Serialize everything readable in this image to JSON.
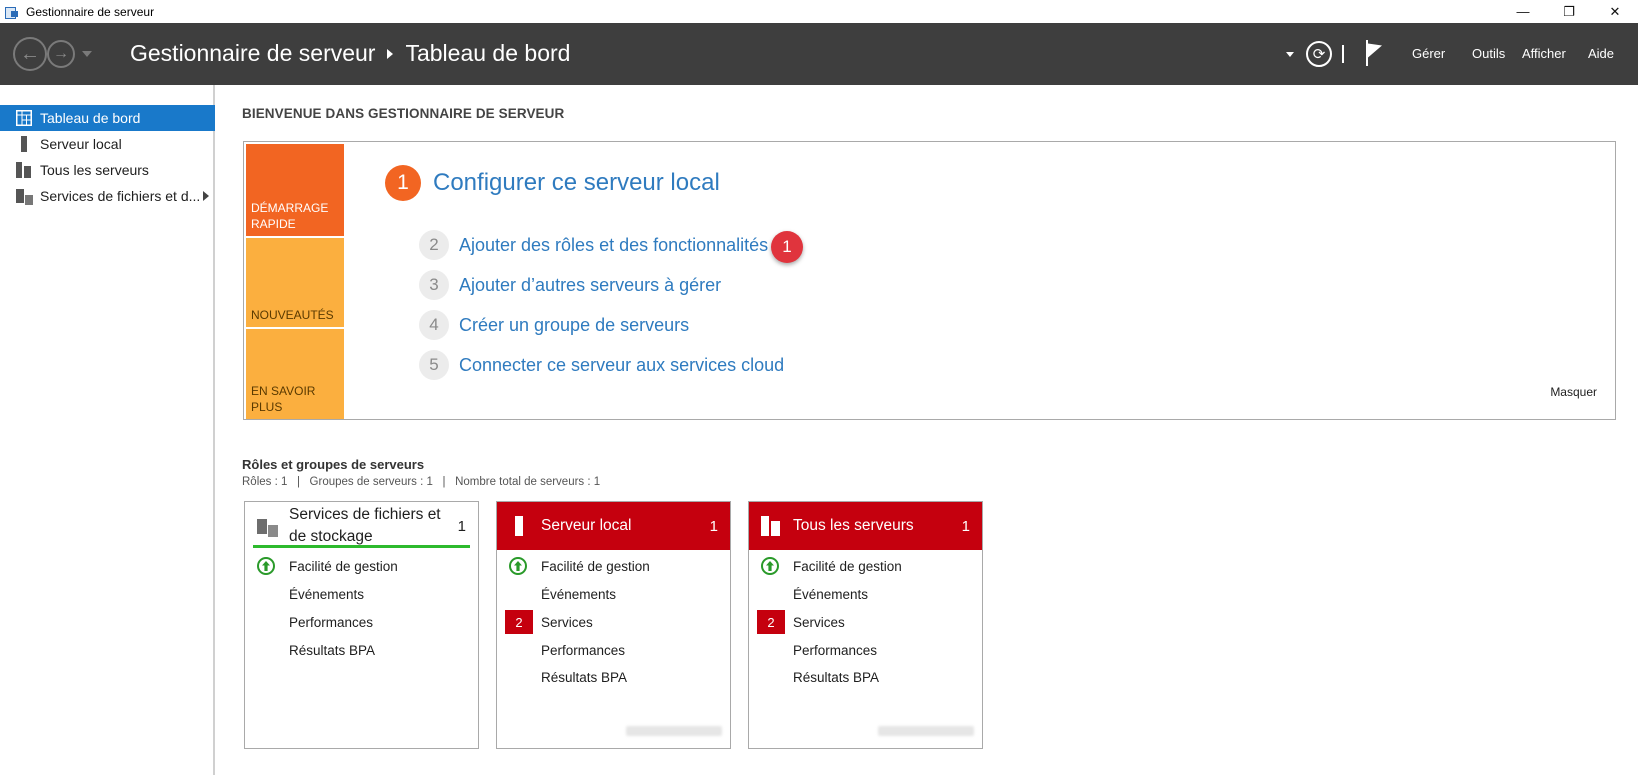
{
  "window": {
    "title": "Gestionnaire de serveur",
    "controls": {
      "minimize": "—",
      "restore": "❐",
      "close": "✕"
    }
  },
  "header": {
    "breadcrumb": [
      "Gestionnaire de serveur",
      "Tableau de bord"
    ],
    "menu": [
      "Gérer",
      "Outils",
      "Afficher",
      "Aide"
    ],
    "refresh_glyph": "⟳"
  },
  "sidebar": {
    "items": [
      {
        "label": "Tableau de bord",
        "icon": "dashboard-icon",
        "active": true
      },
      {
        "label": "Serveur local",
        "icon": "server-icon"
      },
      {
        "label": "Tous les serveurs",
        "icon": "servers-icon"
      },
      {
        "label": "Services de fichiers et d...",
        "icon": "file-services-icon",
        "expandable": true
      }
    ]
  },
  "welcome": {
    "heading": "BIENVENUE DANS GESTIONNAIRE DE SERVEUR",
    "tabs": [
      "DÉMARRAGE RAPIDE",
      "NOUVEAUTÉS",
      "EN SAVOIR PLUS"
    ],
    "steps": [
      {
        "num": "1",
        "label": "Configurer ce serveur local"
      },
      {
        "num": "2",
        "label": "Ajouter des rôles et des fonctionnalités"
      },
      {
        "num": "3",
        "label": "Ajouter d’autres serveurs à gérer"
      },
      {
        "num": "4",
        "label": "Créer un groupe de serveurs"
      },
      {
        "num": "5",
        "label": "Connecter ce serveur aux services cloud"
      }
    ],
    "annotation_badge": "1",
    "hide_link": "Masquer"
  },
  "roles": {
    "title": "Rôles et groupes de serveurs",
    "summary": "Rôles : 1   |   Groupes de serveurs : 1   |   Nombre total de serveurs : 1",
    "tiles": [
      {
        "name": "Services de fichiers et de stockage",
        "count": "1",
        "rows": [
          {
            "label": "Facilité de gestion",
            "status": "ok"
          },
          {
            "label": "Événements"
          },
          {
            "label": "Performances"
          },
          {
            "label": "Résultats BPA"
          }
        ]
      },
      {
        "name": "Serveur local",
        "count": "1",
        "rows": [
          {
            "label": "Facilité de gestion",
            "status": "ok"
          },
          {
            "label": "Événements"
          },
          {
            "label": "Services",
            "alert": "2"
          },
          {
            "label": "Performances"
          },
          {
            "label": "Résultats BPA"
          }
        ]
      },
      {
        "name": "Tous les serveurs",
        "count": "1",
        "rows": [
          {
            "label": "Facilité de gestion",
            "status": "ok"
          },
          {
            "label": "Événements"
          },
          {
            "label": "Services",
            "alert": "2"
          },
          {
            "label": "Performances"
          },
          {
            "label": "Résultats BPA"
          }
        ]
      }
    ]
  },
  "colors": {
    "header_bg": "#3e3e3e",
    "sidebar_active": "#1979ca",
    "quick_start_orange": "#f26522",
    "tab_yellow": "#fbaf3f",
    "link_blue": "#2f7bbf",
    "tile_red": "#c5000e",
    "ok_green": "#2a9a2a"
  }
}
